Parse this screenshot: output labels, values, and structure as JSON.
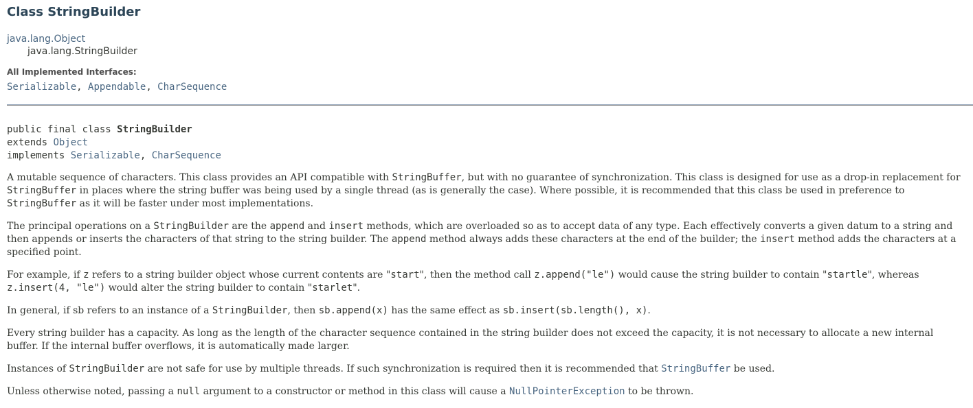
{
  "title": "Class StringBuilder",
  "hierarchy": {
    "parent": "java.lang.Object",
    "child": "java.lang.StringBuilder"
  },
  "interfaces": {
    "label": "All Implemented Interfaces:",
    "items": [
      "Serializable",
      "Appendable",
      "CharSequence"
    ],
    "sep": ", "
  },
  "declaration": {
    "line1_prefix": "public final class ",
    "class_name": "StringBuilder",
    "extends_kw": "extends ",
    "extends_name": "Object",
    "implements_kw": "implements ",
    "impl1": "Serializable",
    "impl_sep": ", ",
    "impl2": "CharSequence"
  },
  "p1": {
    "t1": "A mutable sequence of characters. This class provides an API compatible with ",
    "c1": "StringBuffer",
    "t2": ", but with no guarantee of synchronization. This class is designed for use as a drop-in replacement for ",
    "c2": "StringBuffer",
    "t3": " in places where the string buffer was being used by a single thread (as is generally the case). Where possible, it is recommended that this class be used in preference to ",
    "c3": "StringBuffer",
    "t4": " as it will be faster under most implementations."
  },
  "p2": {
    "t1": "The principal operations on a ",
    "c1": "StringBuilder",
    "t2": " are the ",
    "c2": "append",
    "t3": " and ",
    "c3": "insert",
    "t4": " methods, which are overloaded so as to accept data of any type. Each effectively converts a given datum to a string and then appends or inserts the characters of that string to the string builder. The ",
    "c4": "append",
    "t5": " method always adds these characters at the end of the builder; the ",
    "c5": "insert",
    "t6": " method adds the characters at a specified point."
  },
  "p3": {
    "t1": "For example, if ",
    "c1": "z",
    "t2": " refers to a string builder object whose current contents are \"",
    "c2": "start",
    "t3": "\", then the method call ",
    "c3": "z.append(\"le\")",
    "t4": " would cause the string builder to contain \"",
    "c4": "startle",
    "t5": "\", whereas ",
    "c5": "z.insert(4, \"le\")",
    "t6": " would alter the string builder to contain \"",
    "c6": "starlet",
    "t7": "\"."
  },
  "p4": {
    "t1": "In general, if sb refers to an instance of a ",
    "c1": "StringBuilder",
    "t2": ", then ",
    "c2": "sb.append(x)",
    "t3": " has the same effect as ",
    "c3": "sb.insert(sb.length(), x)",
    "t4": "."
  },
  "p5": {
    "t1": "Every string builder has a capacity. As long as the length of the character sequence contained in the string builder does not exceed the capacity, it is not necessary to allocate a new internal buffer. If the internal buffer overflows, it is automatically made larger."
  },
  "p6": {
    "t1": "Instances of ",
    "c1": "StringBuilder",
    "t2": " are not safe for use by multiple threads. If such synchronization is required then it is recommended that ",
    "l1": "StringBuffer",
    "t3": " be used."
  },
  "p7": {
    "t1": "Unless otherwise noted, passing a ",
    "c1": "null",
    "t2": " argument to a constructor or method in this class will cause a ",
    "l1": "NullPointerException",
    "t3": " to be thrown."
  }
}
